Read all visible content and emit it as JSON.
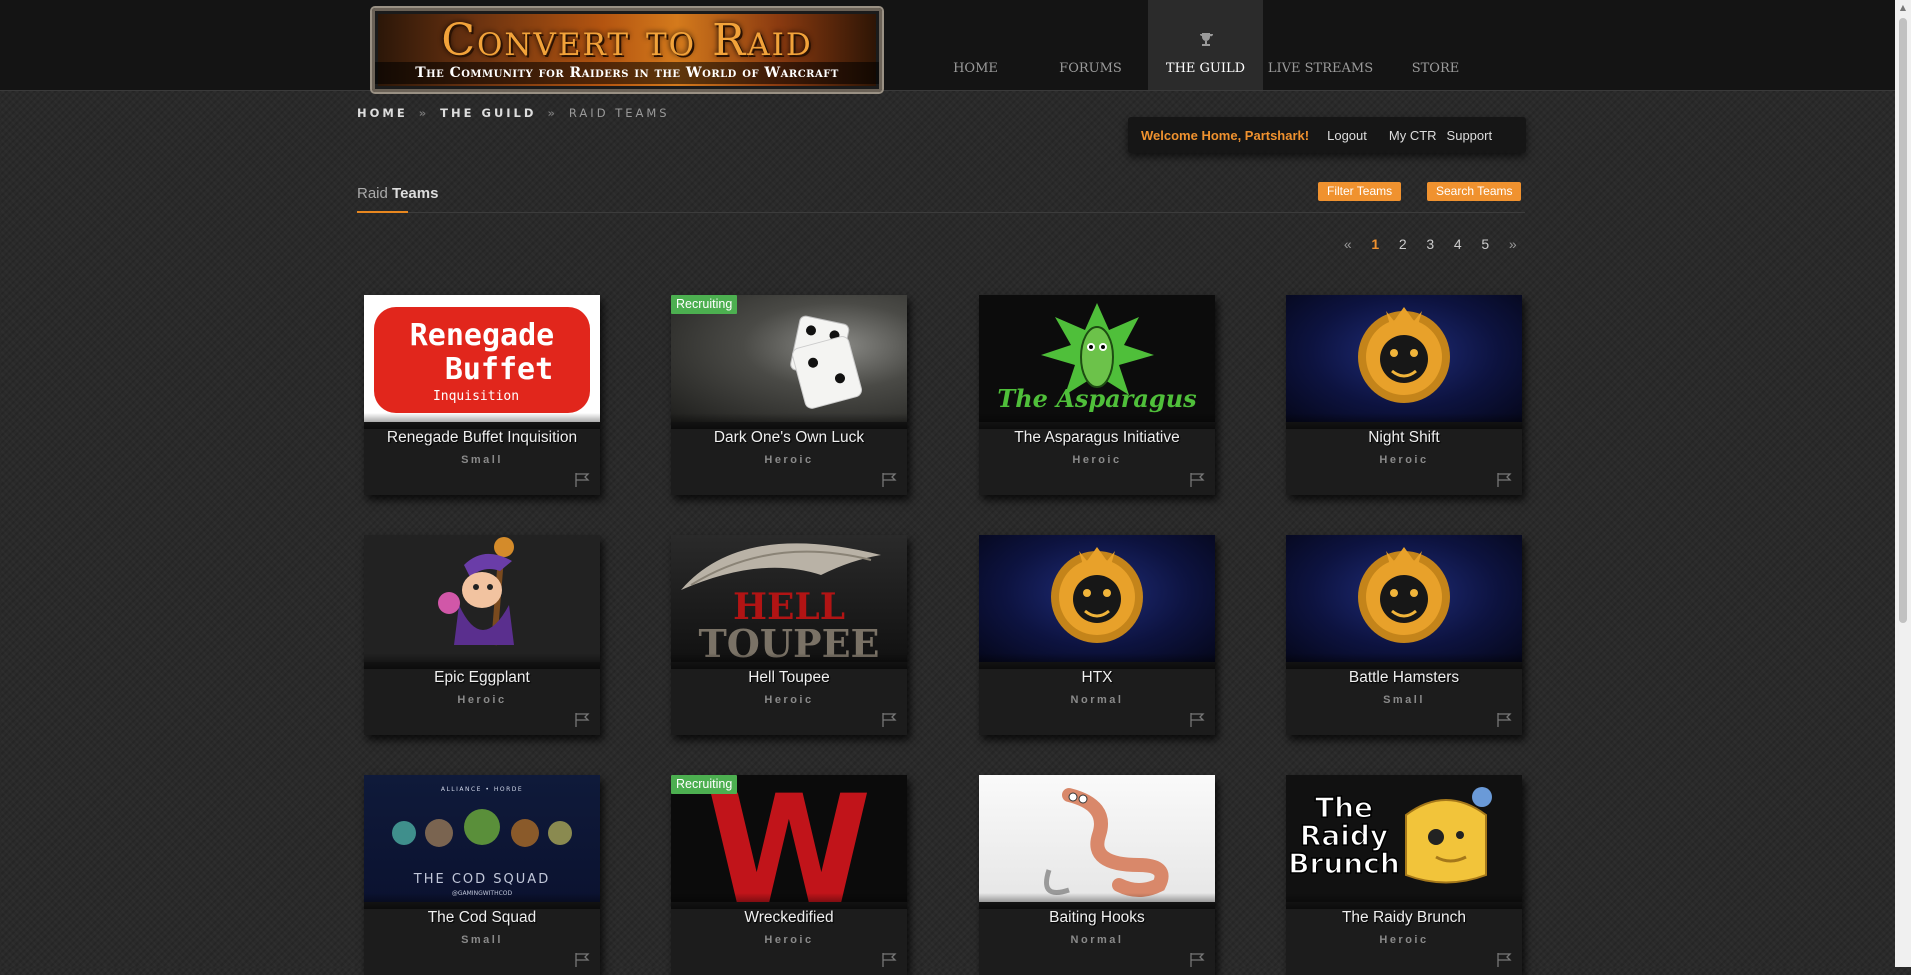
{
  "logo": {
    "title": "Convert to Raid",
    "subtitle": "The Community for Raiders in the World of Warcraft"
  },
  "nav": {
    "items": [
      "HOME",
      "FORUMS",
      "THE GUILD",
      "LIVE STREAMS",
      "STORE"
    ]
  },
  "breadcrumb": {
    "home": "HOME",
    "guild": "THE GUILD",
    "current": "RAID TEAMS",
    "sep": "»"
  },
  "user": {
    "welcome": "Welcome Home, Partshark!",
    "logout": "Logout",
    "my_ctr": "My CTR",
    "support": "Support"
  },
  "section": {
    "title_light": "Raid",
    "title_bold": "Teams",
    "filter_label": "Filter Teams",
    "search_label": "Search Teams"
  },
  "pager": {
    "prev": "«",
    "pages": [
      "1",
      "2",
      "3",
      "4",
      "5"
    ],
    "next": "»",
    "current": "1"
  },
  "recruiting_label": "Recruiting",
  "teams": [
    {
      "name": "Renegade Buffet Inquisition",
      "size": "Small",
      "recruiting": false,
      "logo_lines": [
        "Renegade",
        "Buffet",
        "Inquisition"
      ]
    },
    {
      "name": "Dark One's Own Luck",
      "size": "Heroic",
      "recruiting": true
    },
    {
      "name": "The Asparagus Initiative",
      "size": "Heroic",
      "recruiting": false,
      "logo_text": "The Asparagus"
    },
    {
      "name": "Night Shift",
      "size": "Heroic",
      "recruiting": false
    },
    {
      "name": "Epic Eggplant",
      "size": "Heroic",
      "recruiting": false
    },
    {
      "name": "Hell Toupee",
      "size": "Heroic",
      "recruiting": false,
      "logo_lines": [
        "HELL",
        "TOUPEE"
      ]
    },
    {
      "name": "HTX",
      "size": "Normal",
      "recruiting": false
    },
    {
      "name": "Battle Hamsters",
      "size": "Small",
      "recruiting": false
    },
    {
      "name": "The Cod Squad",
      "size": "Small",
      "recruiting": false,
      "logo_lines": [
        "ALLIANCE • HORDE",
        "THE COD SQUAD",
        "@GAMINGWITHCOD"
      ]
    },
    {
      "name": "Wreckedified",
      "size": "Heroic",
      "recruiting": true,
      "logo_text": "W"
    },
    {
      "name": "Baiting Hooks",
      "size": "Normal",
      "recruiting": false
    },
    {
      "name": "The Raidy Brunch",
      "size": "Heroic",
      "recruiting": false,
      "logo_lines": [
        "The",
        "Raidy",
        "Brunch"
      ]
    }
  ],
  "icons": {
    "nav_guild": "trophy-icon",
    "card_flag": "flag-icon"
  },
  "colors": {
    "accent": "#f0922f",
    "recruiting": "#4caf50"
  }
}
